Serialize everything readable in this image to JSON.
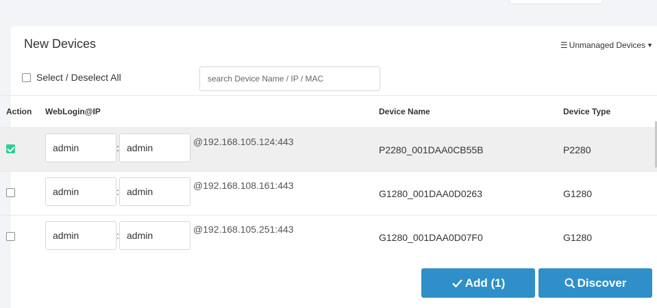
{
  "panel": {
    "title": "New Devices",
    "menu_label": "Unmanaged Devices",
    "select_all_label": "Select / Deselect All",
    "search_placeholder": "search Device Name / IP / MAC"
  },
  "table": {
    "headers": [
      "Action",
      "WebLogin@IP",
      "Device Name",
      "Device Type"
    ],
    "rows": [
      {
        "checked": true,
        "user": "admin",
        "password": "admin",
        "ip": "@192.168.105.124:443",
        "name": "P2280_001DAA0CB55B",
        "type": "P2280"
      },
      {
        "checked": false,
        "user": "admin",
        "password": "admin",
        "ip": "@192.168.108.161:443",
        "name": "G1280_001DAA0D0263",
        "type": "G1280"
      },
      {
        "checked": false,
        "user": "admin",
        "password": "admin",
        "ip": "@192.168.105.251:443",
        "name": "G1280_001DAA0D07F0",
        "type": "G1280"
      }
    ]
  },
  "buttons": {
    "add_label": "Add (1)",
    "discover_label": "Discover"
  },
  "colors": {
    "accent": "#2f8fc9",
    "checked": "#2ecc9a"
  }
}
